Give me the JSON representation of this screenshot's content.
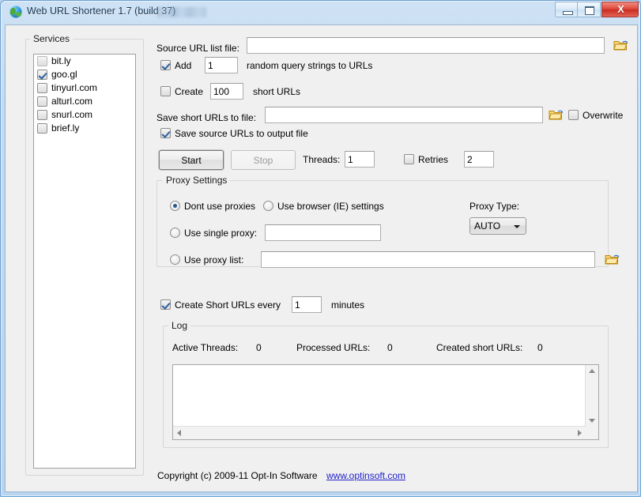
{
  "window": {
    "title": "Web URL Shortener 1.7 (build 37)",
    "icon": "globe-icon",
    "minimize_label": "—",
    "maximize_label": "□",
    "close_label": "X"
  },
  "services": {
    "group_title": "Services",
    "items": [
      {
        "label": "bit.ly",
        "checked": false
      },
      {
        "label": "goo.gl",
        "checked": true
      },
      {
        "label": "tinyurl.com",
        "checked": false
      },
      {
        "label": "alturl.com",
        "checked": false
      },
      {
        "label": "snurl.com",
        "checked": false
      },
      {
        "label": "brief.ly",
        "checked": false
      }
    ]
  },
  "source": {
    "label": "Source URL list file:",
    "value": "",
    "browse_icon": "folder-open-icon"
  },
  "add_query": {
    "label": "Add",
    "checked": true,
    "count": "1",
    "suffix": "random query strings to URLs"
  },
  "create_urls": {
    "label": "Create",
    "checked": false,
    "count": "100",
    "suffix": "short URLs"
  },
  "save_to": {
    "label": "Save short URLs to file:",
    "value": "",
    "browse_icon": "folder-open-icon",
    "overwrite_label": "Overwrite",
    "overwrite_checked": false
  },
  "save_source": {
    "label": "Save source URLs to output file",
    "checked": true
  },
  "actions": {
    "start_label": "Start",
    "stop_label": "Stop",
    "threads_label": "Threads:",
    "threads_value": "1",
    "retries_label": "Retries",
    "retries_checked": false,
    "retries_value": "2"
  },
  "proxy": {
    "group_title": "Proxy Settings",
    "option_none": "Dont use proxies",
    "option_browser": "Use browser (IE) settings",
    "option_single": "Use single proxy:",
    "option_list": "Use proxy list:",
    "selected": "none",
    "single_value": "",
    "list_value": "",
    "list_browse_icon": "folder-open-icon",
    "type_label": "Proxy Type:",
    "type_value": "AUTO"
  },
  "schedule": {
    "label": "Create Short URLs every",
    "checked": true,
    "value": "1",
    "unit": "minutes"
  },
  "log": {
    "group_title": "Log",
    "active_threads_label": "Active Threads:",
    "active_threads_value": "0",
    "processed_label": "Processed URLs:",
    "processed_value": "0",
    "created_label": "Created short URLs:",
    "created_value": "0",
    "content": ""
  },
  "footer": {
    "copyright": "Copyright (c) 2009-11 Opt-In Software",
    "link": "www.optinsoft.com"
  },
  "colors": {
    "link": "#2222cc",
    "accent": "#27598f",
    "close_button": "#c92d21",
    "client_bg": "#f0f0f0"
  }
}
